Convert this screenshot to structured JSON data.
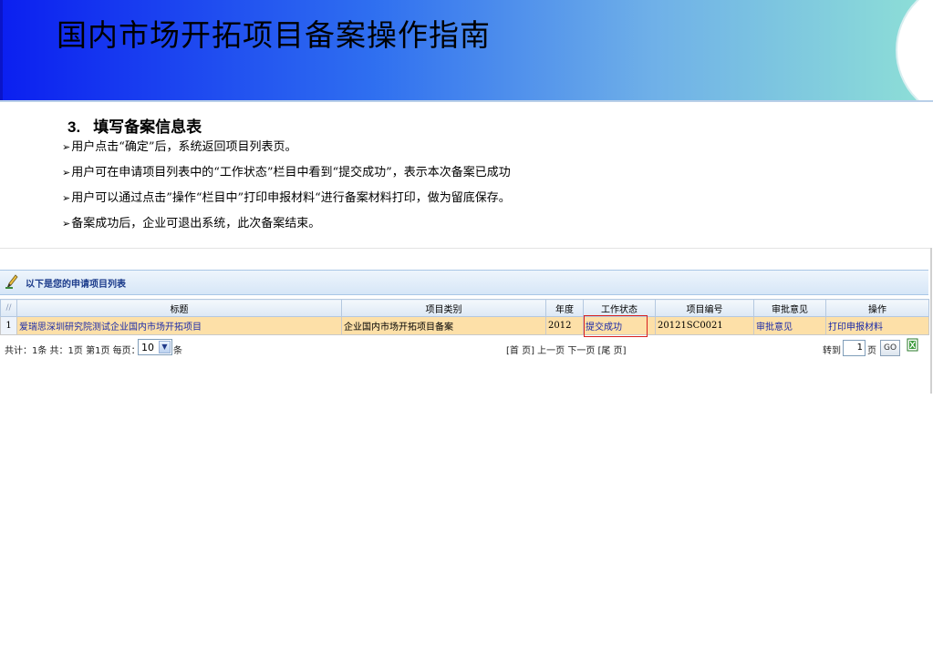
{
  "slide": {
    "title": "国内市场开拓项目备案操作指南",
    "section_number": "3.",
    "section_title": "填写备案信息表",
    "bullets": [
      "用户点击“确定”后，系统返回项目列表页。",
      "用户可在申请项目列表中的“工作状态”栏目中看到“提交成功”，表示本次备案已成功",
      "用户可以通过点击”操作“栏目中”打印申报材料“进行备案材料打印，做为留底保存。",
      "备案成功后，企业可退出系统，此次备案结束。"
    ],
    "bullet_mark": "➢"
  },
  "list": {
    "heading": "以下是您的申请项目列表",
    "columns": [
      "标题",
      "项目类别",
      "年度",
      "工作状态",
      "项目编号",
      "审批意见",
      "操作"
    ],
    "row_number_header": "//",
    "rows": [
      {
        "no": "1",
        "title": "爱瑞思深圳研究院测试企业国内市场开拓项目",
        "category": "企业国内市场开拓项目备案",
        "year": "2012",
        "status": "提交成功",
        "project_id": "20121SC0021",
        "approval": "审批意见",
        "action": "打印申报材料"
      }
    ]
  },
  "pager": {
    "summary": "共计：1条 共：1页 第1页 每页：",
    "page_size": "10",
    "unit": "条",
    "nav": "[首 页] 上一页 下一页 [尾 页]",
    "goto_label": "转到",
    "goto_value": "1",
    "page_unit": "页",
    "go_label": "GO"
  },
  "colors": {
    "highlight_box": "#d81f1f",
    "row_background": "#fde0a8",
    "link": "#1a2aa8"
  }
}
